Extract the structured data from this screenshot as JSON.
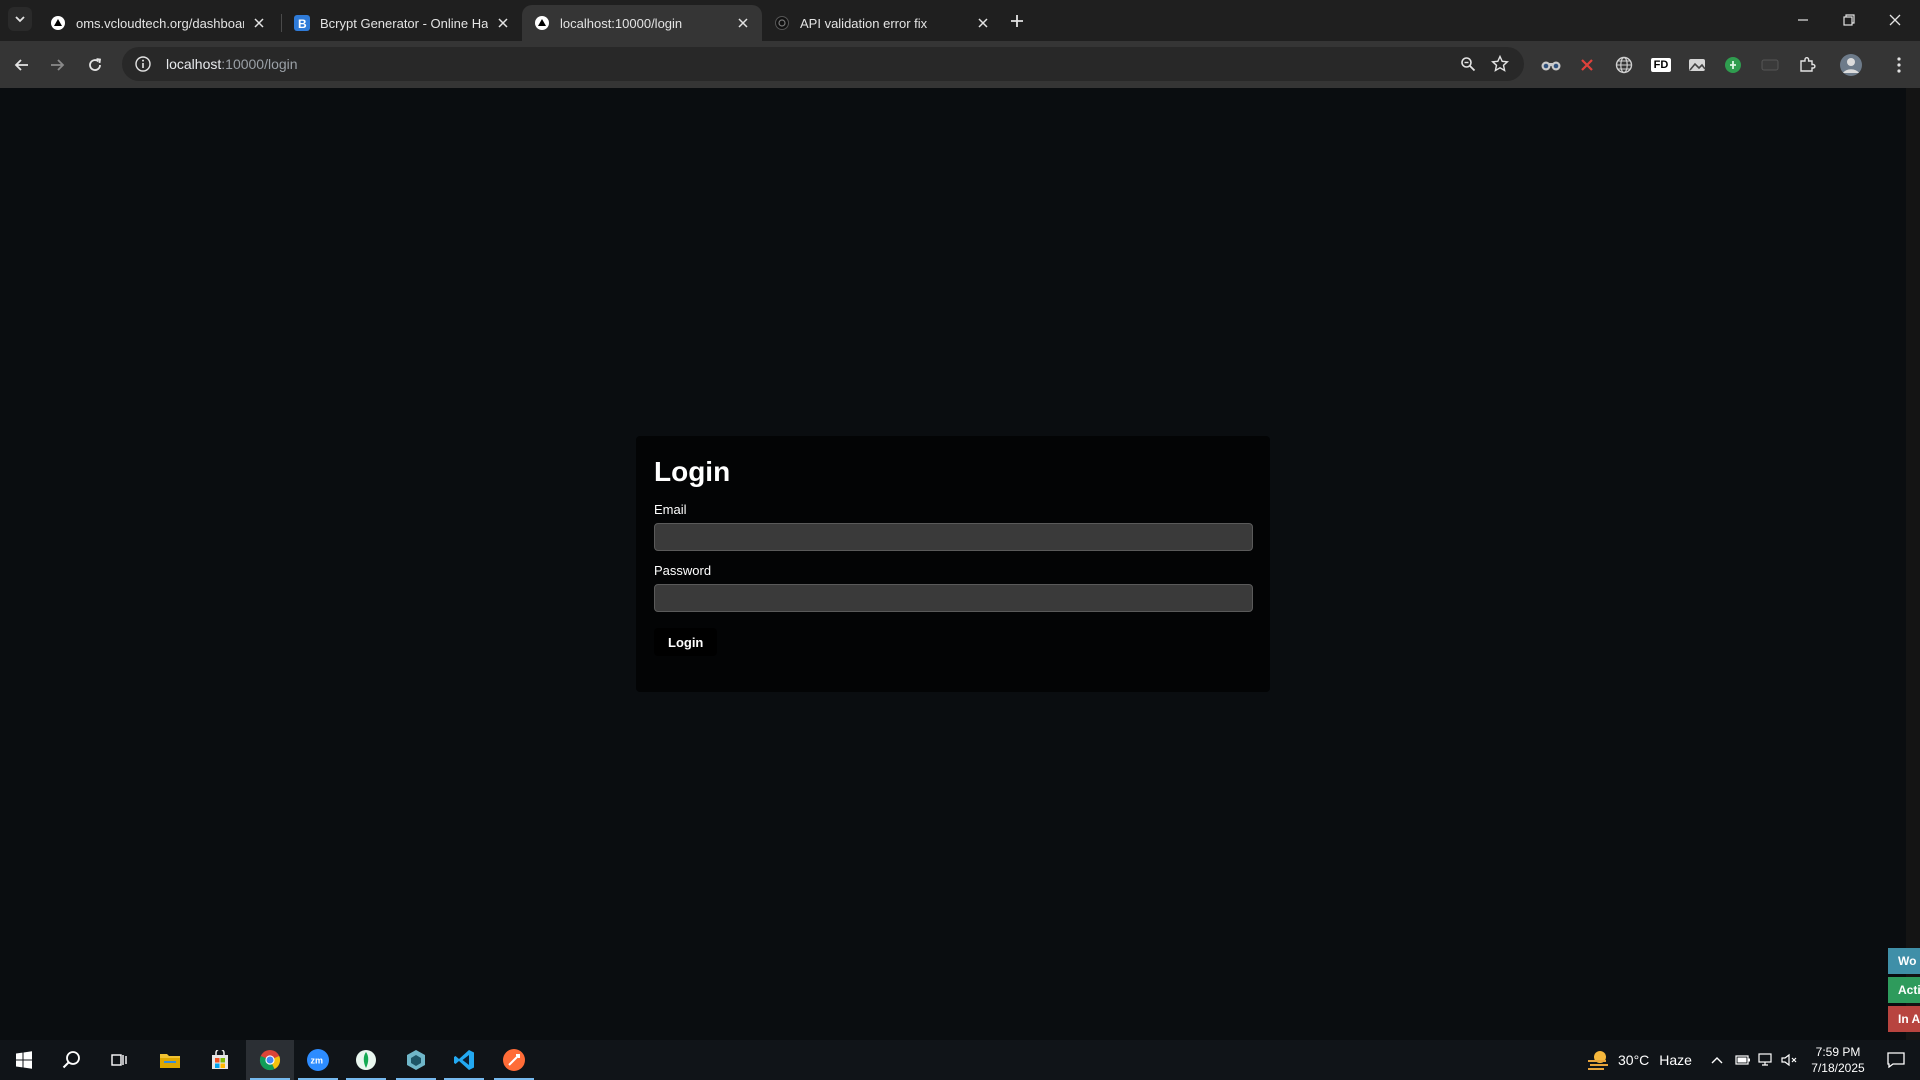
{
  "browser": {
    "tabs": [
      {
        "title": "oms.vcloudtech.org/dashboard",
        "favicon": "triangle-logo-icon",
        "active": false
      },
      {
        "title": "Bcrypt Generator - Online Hash",
        "favicon": "bcrypt-b-icon",
        "active": false
      },
      {
        "title": "localhost:10000/login",
        "favicon": "triangle-logo-icon",
        "active": true
      },
      {
        "title": "API validation error fix",
        "favicon": "chatgpt-icon",
        "active": false
      }
    ],
    "address": {
      "host": "localhost",
      "path": ":10000/login"
    },
    "extensions": [
      "binoculars-icon",
      "x-icon",
      "globe-icon",
      "fd-icon",
      "image-icon",
      "green-circle-icon",
      "tablet-icon",
      "puzzle-icon"
    ],
    "extension_text": {
      "fd": "FD"
    }
  },
  "page": {
    "title": "Login",
    "email_label": "Email",
    "email_value": "",
    "password_label": "Password",
    "password_value": "",
    "submit_label": "Login",
    "side_widgets": [
      {
        "label": "Wo",
        "color": "#3f8fa8"
      },
      {
        "label": "Acti",
        "color": "#2e9b5c"
      },
      {
        "label": "In A",
        "color": "#b8443f"
      }
    ]
  },
  "taskbar": {
    "apps": [
      "windows-start-icon",
      "search-icon",
      "task-view-icon",
      "file-explorer-icon",
      "store-icon",
      "chrome-icon",
      "zoom-icon",
      "mongodb-compass-icon",
      "app-icon",
      "vscode-icon",
      "postman-icon"
    ],
    "weather": {
      "temp": "30°C",
      "condition": "Haze"
    },
    "clock": {
      "time": "7:59 PM",
      "date": "7/18/2025"
    }
  }
}
